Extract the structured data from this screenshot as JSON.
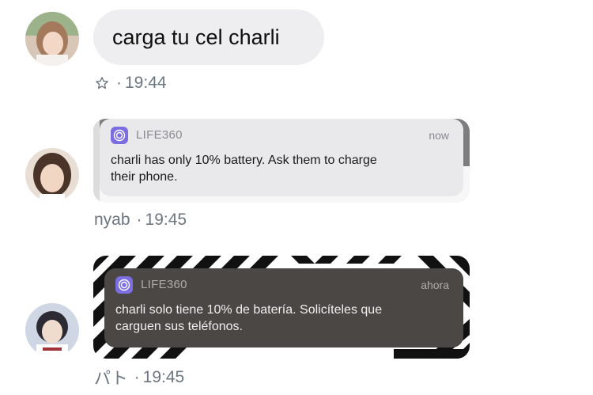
{
  "messages": [
    {
      "sender": "",
      "text": "carga tu cel charli",
      "meta_icon": "star-outline-icon",
      "time": "19:44"
    },
    {
      "sender": "nyab",
      "time": "19:45",
      "notification": {
        "app_name": "LIFE360",
        "time_label": "now",
        "body_line1": "charli has only 10% battery. Ask them to charge",
        "body_line2": "their phone."
      }
    },
    {
      "sender": "パト",
      "time": "19:45",
      "notification": {
        "app_name": "LIFE360",
        "time_label": "ahora",
        "body_line1": "charli solo tiene 10% de batería. Solicíteles que",
        "body_line2": "carguen sus teléfonos."
      }
    }
  ],
  "separator": "·",
  "colors": {
    "bubble_bg": "#eeeef0",
    "meta_text": "#6b7680",
    "life360_icon": "#7b6ee0",
    "dark_notification": "#4a4744"
  }
}
